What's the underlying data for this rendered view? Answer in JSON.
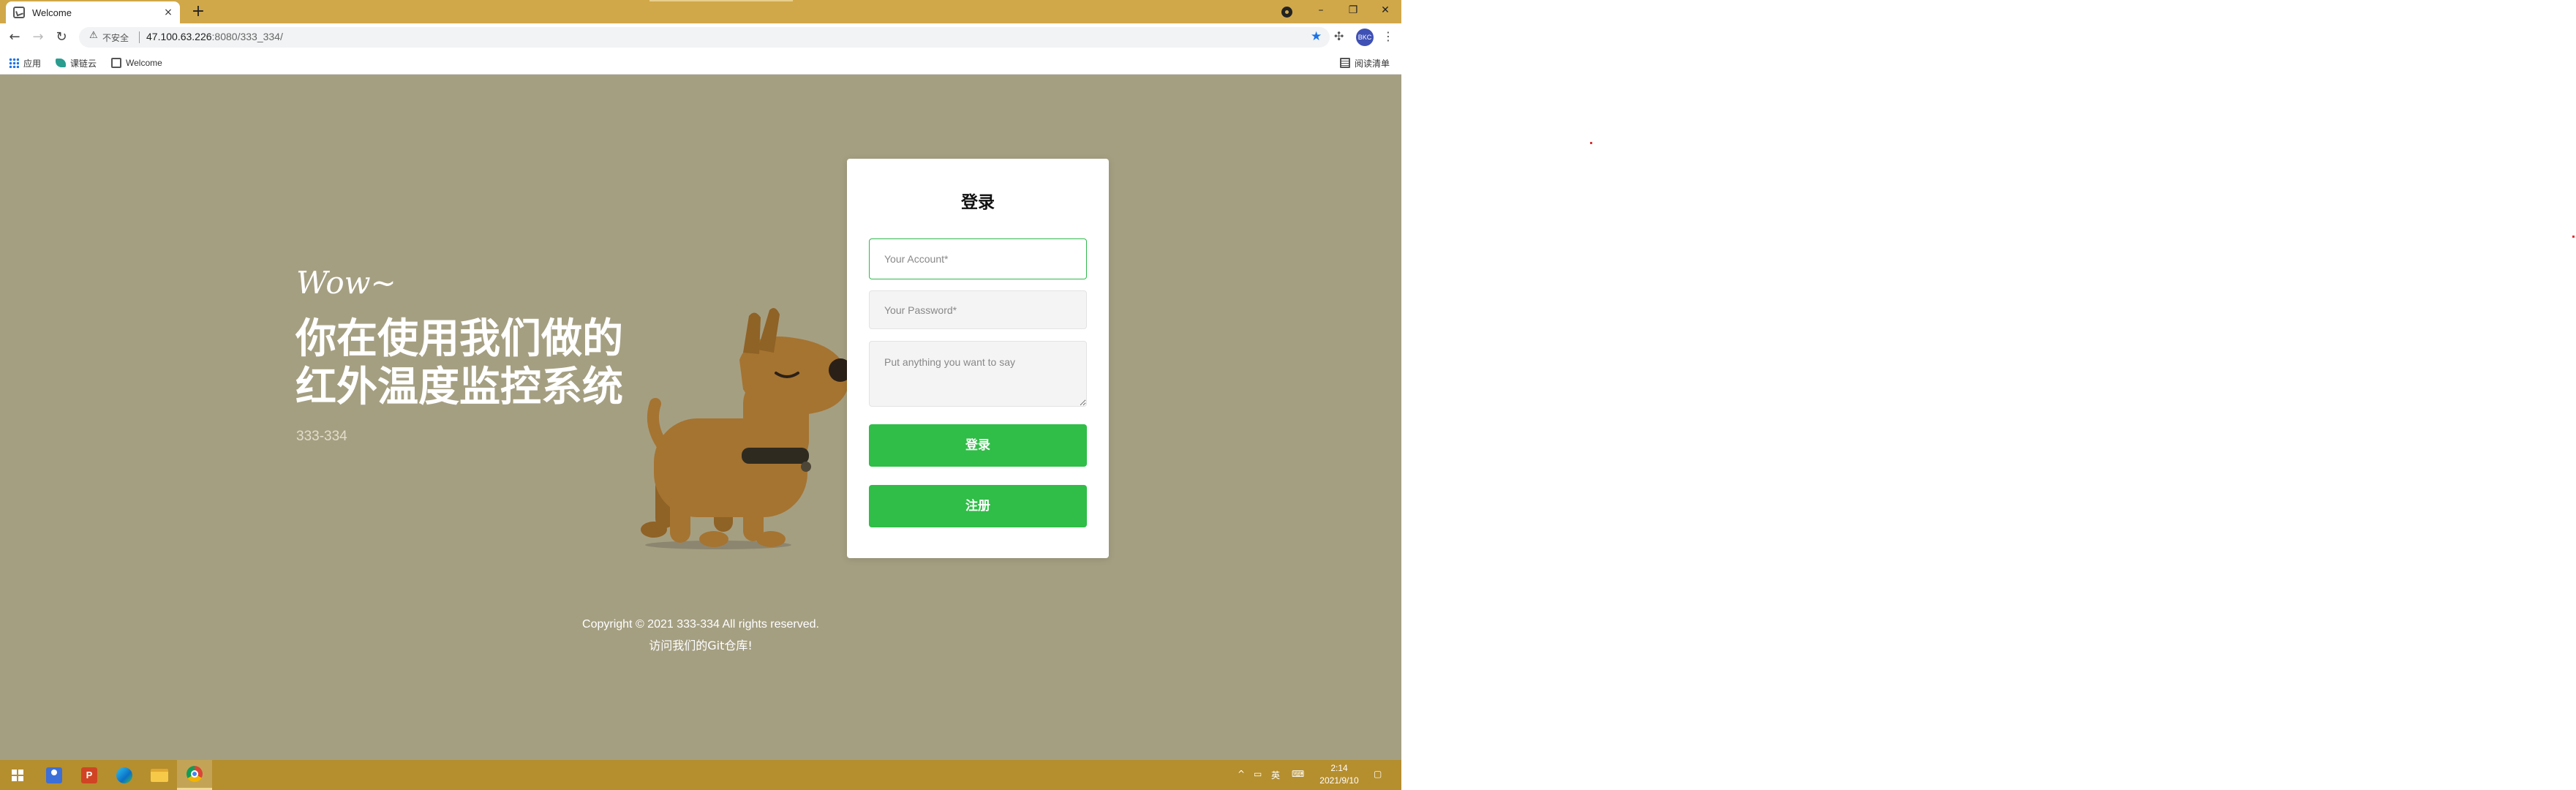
{
  "browser": {
    "tab_title": "Welcome",
    "tab_close": "×",
    "new_tab": "+",
    "address": {
      "insecure_label": "不安全",
      "url_host": "47.100.63.226",
      "url_path": ":8080/333_334/"
    },
    "window": {
      "minimize": "–",
      "restore": "❐",
      "close": "✕"
    },
    "profile_initials": "BKC",
    "bookmarks": [
      {
        "label": "应用",
        "icon": "apps-grid-icon"
      },
      {
        "label": "课链云",
        "icon": "bookmark-icon"
      },
      {
        "label": "Welcome",
        "icon": "page-icon"
      }
    ],
    "reading_list": "阅读清单"
  },
  "hero": {
    "wow": "Wow~",
    "headline_line1": "你在使用我们做的",
    "headline_line2": "红外温度监控系统",
    "subtitle": "333-334"
  },
  "login": {
    "title": "登录",
    "account_placeholder": "Your Account*",
    "password_placeholder": "Your Password*",
    "message_placeholder": "Put anything you want to say",
    "login_button": "登录",
    "register_button": "注册"
  },
  "footer": {
    "copyright": "Copyright © 2021 333-334 All rights reserved.",
    "git_link": "访问我们的Git仓库!"
  },
  "taskbar": {
    "ime": "英",
    "time": "2:14",
    "date": "2021/9/10"
  },
  "colors": {
    "page_bg": "#a59f82",
    "titlebar": "#d0a84a",
    "taskbar": "#b58e2e",
    "accent_green": "#30bd48"
  }
}
